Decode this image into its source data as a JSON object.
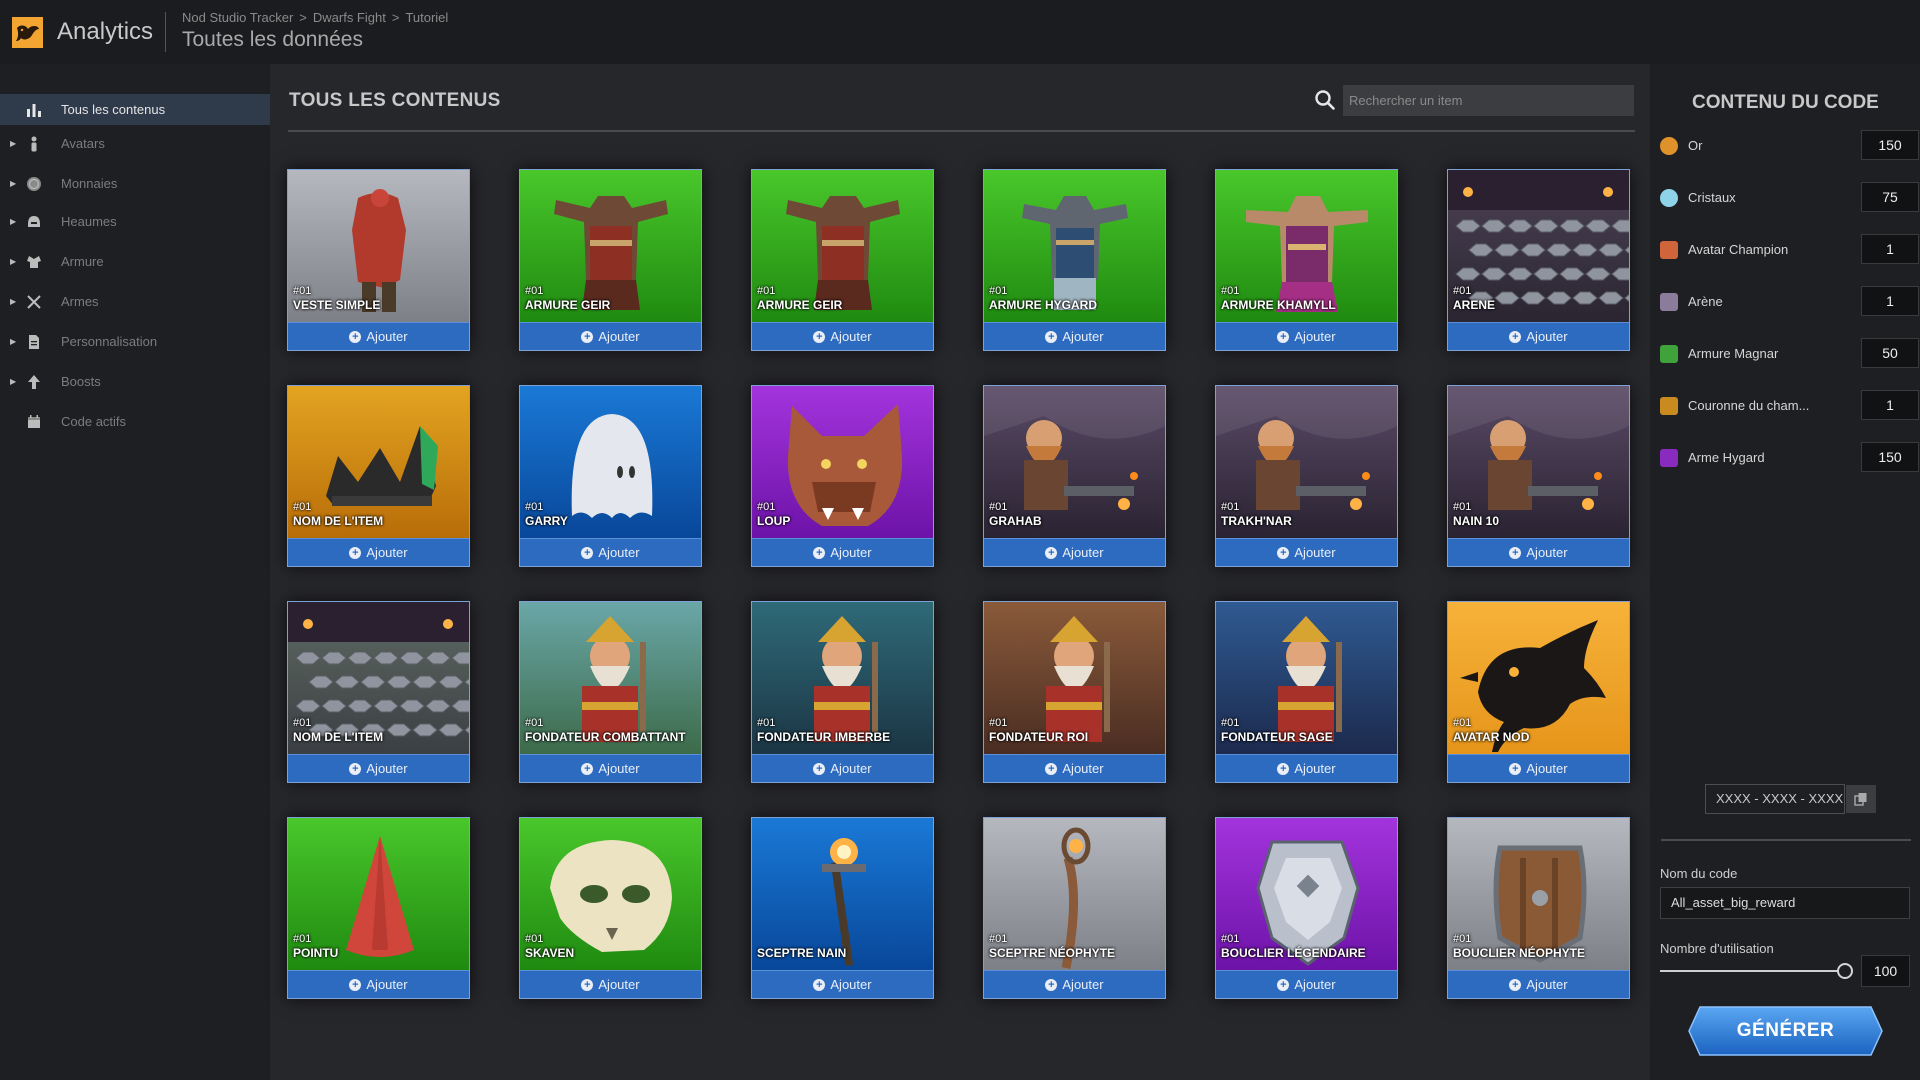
{
  "app": {
    "title": "Analytics",
    "breadcrumb": [
      "Nod Studio Tracker",
      "Dwarfs Fight",
      "Tutoriel"
    ],
    "breadcrumb_sep": ">",
    "page_title": "Toutes les données"
  },
  "sidebar": {
    "items": [
      {
        "label": "Tous les contenus",
        "icon": "bar-chart-icon",
        "active": true,
        "expandable": false
      },
      {
        "label": "Avatars",
        "icon": "person-icon",
        "active": false,
        "expandable": true
      },
      {
        "label": "Monnaies",
        "icon": "coin-icon",
        "active": false,
        "expandable": true
      },
      {
        "label": "Heaumes",
        "icon": "helmet-icon",
        "active": false,
        "expandable": true
      },
      {
        "label": "Armure",
        "icon": "armor-icon",
        "active": false,
        "expandable": true
      },
      {
        "label": "Armes",
        "icon": "crossed-swords-icon",
        "active": false,
        "expandable": true
      },
      {
        "label": "Personnalisation",
        "icon": "document-icon",
        "active": false,
        "expandable": true
      },
      {
        "label": "Boosts",
        "icon": "arrow-up-icon",
        "active": false,
        "expandable": true
      },
      {
        "label": "Code actifs",
        "icon": "calendar-icon",
        "active": false,
        "expandable": false
      }
    ]
  },
  "main": {
    "title": "TOUS LES CONTENUS",
    "search_placeholder": "Rechercher un item",
    "add_label": "Ajouter",
    "items": [
      {
        "num": "#01",
        "name": "VESTE SIMPLE",
        "bg": "grey",
        "art": "vest"
      },
      {
        "num": "#01",
        "name": "ARMURE GEIR",
        "bg": "green",
        "art": "armor-red"
      },
      {
        "num": "#01",
        "name": "ARMURE GEIR",
        "bg": "green",
        "art": "armor-red"
      },
      {
        "num": "#01",
        "name": "ARMURE HYGARD",
        "bg": "green",
        "art": "armor-blue"
      },
      {
        "num": "#01",
        "name": "ARMURE KHAMYLL",
        "bg": "green",
        "art": "armor-purple"
      },
      {
        "num": "#01",
        "name": "ARENE",
        "bg": "scene-dark",
        "art": "arena"
      },
      {
        "num": "#01",
        "name": "NOM DE L'ITEM",
        "bg": "orange",
        "art": "crown"
      },
      {
        "num": "#01",
        "name": "GARRY",
        "bg": "blue",
        "art": "ghost"
      },
      {
        "num": "#01",
        "name": "LOUP",
        "bg": "purple",
        "art": "wolf"
      },
      {
        "num": "#01",
        "name": "GRAHAB",
        "bg": "scene",
        "art": "dwarf"
      },
      {
        "num": "#01",
        "name": "TRAKH'NAR",
        "bg": "scene",
        "art": "dwarf"
      },
      {
        "num": "#01",
        "name": "NAIN 10",
        "bg": "scene",
        "art": "dwarf"
      },
      {
        "num": "#01",
        "name": "NOM DE L'ITEM",
        "bg": "scene-grey",
        "art": "arena"
      },
      {
        "num": "#01",
        "name": "FONDATEUR COMBATTANT",
        "bg": "scene-green",
        "art": "hero"
      },
      {
        "num": "#01",
        "name": "FONDATEUR IMBERBE",
        "bg": "scene-teal",
        "art": "hero"
      },
      {
        "num": "#01",
        "name": "FONDATEUR ROI",
        "bg": "scene-brown",
        "art": "hero"
      },
      {
        "num": "#01",
        "name": "FONDATEUR SAGE",
        "bg": "scene-navy",
        "art": "hero"
      },
      {
        "num": "#01",
        "name": "AVATAR NOD",
        "bg": "orange-bright",
        "art": "bird"
      },
      {
        "num": "#01",
        "name": "POINTU",
        "bg": "green",
        "art": "cone"
      },
      {
        "num": "#01",
        "name": "SKAVEN",
        "bg": "green",
        "art": "skull"
      },
      {
        "num": "",
        "name": "SCEPTRE NAIN",
        "bg": "blue",
        "art": "scepter"
      },
      {
        "num": "#01",
        "name": "SCEPTRE NÉOPHYTE",
        "bg": "grey",
        "art": "staff"
      },
      {
        "num": "#01",
        "name": "BOUCLIER LÉGENDAIRE",
        "bg": "purple",
        "art": "shield-silver"
      },
      {
        "num": "#01",
        "name": "BOUCLIER NÉOPHYTE",
        "bg": "grey",
        "art": "shield-wood"
      }
    ]
  },
  "code_panel": {
    "title": "CONTENU DU CODE",
    "rows": [
      {
        "label": "Or",
        "qty": "150",
        "icon": "gold-coin-icon",
        "color": "#e0922a"
      },
      {
        "label": "Cristaux",
        "qty": "75",
        "icon": "crystal-icon",
        "color": "#8fd3e8"
      },
      {
        "label": "Avatar Champion",
        "qty": "1",
        "icon": "champion-avatar-icon",
        "color": "#d0643a"
      },
      {
        "label": "Arène",
        "qty": "1",
        "icon": "arena-icon",
        "color": "#8c7c9c"
      },
      {
        "label": "Armure Magnar",
        "qty": "50",
        "icon": "armor-thumb-icon",
        "color": "#3fa23a"
      },
      {
        "label": "Couronne du cham...",
        "qty": "1",
        "icon": "crown-thumb-icon",
        "color": "#c98a20"
      },
      {
        "label": "Arme Hygard",
        "qty": "150",
        "icon": "weapon-thumb-icon",
        "color": "#8a2bc0"
      }
    ],
    "code_value": "XXXX - XXXX - XXXX",
    "name_label": "Nom du code",
    "name_value": "All_asset_big_reward",
    "uses_label": "Nombre d'utilisation",
    "uses_value": "100",
    "uses_slider": 1.0,
    "generate_label": "GÉNÉRER"
  },
  "colors": {
    "accent": "#2d6bc1",
    "brand": "#f2a531",
    "card_bg_green": "#2fa219",
    "card_bg_blue": "#0a5bb7",
    "card_bg_purple": "#8a1fc6",
    "card_bg_orange": "#d88a12",
    "card_bg_grey": "#9a9ca3"
  }
}
